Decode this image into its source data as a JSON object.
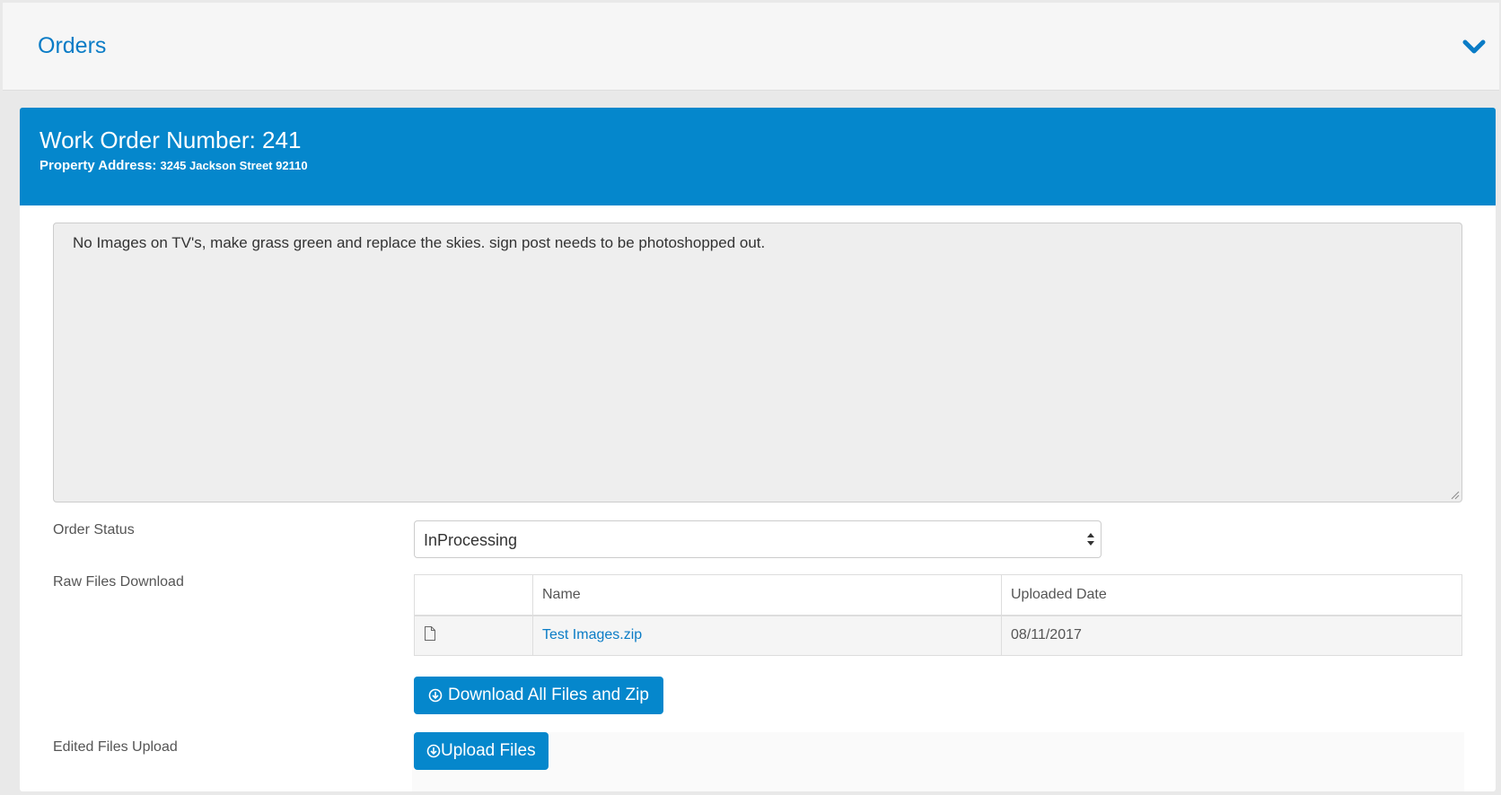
{
  "topbar": {
    "title": "Orders"
  },
  "header": {
    "work_order_label": "Work Order Number:",
    "work_order_number": "241",
    "address_label": "Property Address:",
    "address_value": "3245 Jackson Street 92110"
  },
  "notes": {
    "text": "No Images on TV's, make grass green and replace the skies.  sign post needs to be photoshopped out."
  },
  "order_status": {
    "label": "Order Status",
    "selected": "InProcessing"
  },
  "raw_files": {
    "label": "Raw Files Download",
    "columns": [
      "",
      "Name",
      "Uploaded Date"
    ],
    "rows": [
      {
        "name": "Test Images.zip",
        "uploaded": "08/11/2017"
      }
    ],
    "download_button": "Download All Files and Zip"
  },
  "edited_files": {
    "label": "Edited Files Upload",
    "upload_button": "Upload Files"
  },
  "colors": {
    "accent": "#0587cc",
    "link": "#0a7cc6"
  }
}
